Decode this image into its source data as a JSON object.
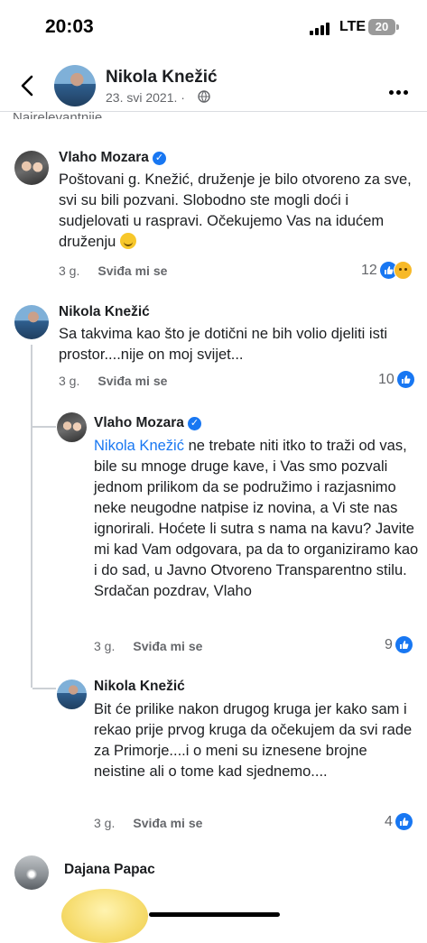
{
  "status_bar": {
    "time": "20:03",
    "network": "LTE",
    "battery": "20"
  },
  "header": {
    "name": "Nikola Knežić",
    "date": "23. svi 2021. ·"
  },
  "sort_label": "Najrelevantnije",
  "comments": [
    {
      "author": "Vlaho Mozara",
      "text": "Poštovani g. Knežić, druženje je bilo otvoreno za sve, svi su bili pozvani. Slobodno ste mogli doći i sudjelovati u raspravi. Očekujemo Vas na idućem druženju",
      "age": "3 g.",
      "like_label": "Sviđa mi se",
      "reactions": "12"
    },
    {
      "author": "Nikola Knežić",
      "text": "Sa takvima kao što je dotični ne bih volio djeliti isti prostor....nije on moj svijet...",
      "age": "3 g.",
      "like_label": "Sviđa mi se",
      "reactions": "10"
    },
    {
      "author": "Vlaho Mozara",
      "mention": "Nikola Knežić",
      "text": "ne trebate niti itko to traži od vas, bile su mnoge druge kave, i Vas smo pozvali jednom prilikom da se podružimo i razjasnimo neke neugodne natpise iz novina, a Vi ste nas ignorirali. Hoćete li sutra s nama na kavu? Javite mi kad Vam odgovara, pa da to organiziramo kao i do sad, u Javno Otvoreno Transparentno stilu. Srdačan pozdrav, Vlaho",
      "age": "3 g.",
      "like_label": "Sviđa mi se",
      "reactions": "9"
    },
    {
      "author": "Nikola Knežić",
      "text": "Bit će prilike nakon drugog kruga jer kako sam i rekao prije prvog kruga da očekujem da svi rade za Primorje....i o meni su iznesene brojne neistine ali o tome kad sjednemo....",
      "age": "3 g.",
      "like_label": "Sviđa mi se",
      "reactions": "4"
    },
    {
      "author": "Dajana Papac"
    }
  ],
  "colors": {
    "accent": "#1877f2",
    "muted": "#65676b"
  }
}
